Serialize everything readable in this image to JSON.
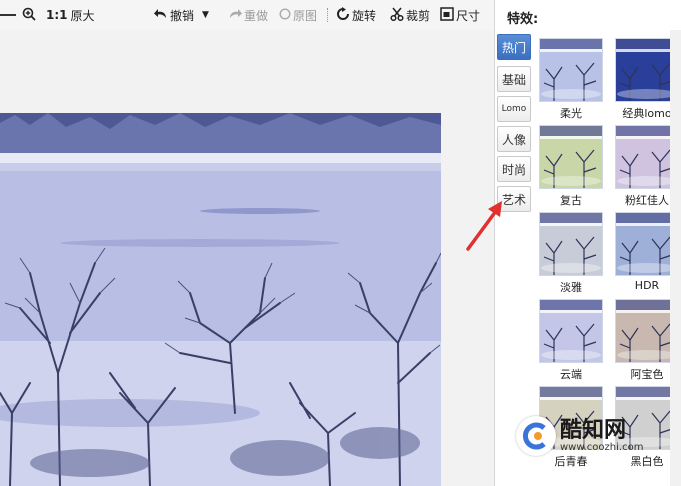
{
  "toolbar": {
    "zoom_fit_label": "1:1",
    "original_size_label": "原大",
    "undo_label": "撤销",
    "redo_label": "重做",
    "original_image_label": "原图",
    "rotate_label": "旋转",
    "crop_label": "裁剪",
    "size_label": "尺寸"
  },
  "panel": {
    "title": "特效:",
    "tabs": [
      {
        "label": "热门"
      },
      {
        "label": "基础"
      },
      {
        "label": "Lomo"
      },
      {
        "label": "人像"
      },
      {
        "label": "时尚"
      },
      {
        "label": "艺术"
      }
    ],
    "effects": [
      {
        "label": "柔光",
        "tint": "#b7c2e6"
      },
      {
        "label": "经典lomo",
        "tint": "#2a3f9a"
      },
      {
        "label": "复古",
        "tint": "#c9d6a8"
      },
      {
        "label": "粉红佳人",
        "tint": "#cfc3e0"
      },
      {
        "label": "淡雅",
        "tint": "#c8ccd8"
      },
      {
        "label": "HDR",
        "tint": "#9eb0d8"
      },
      {
        "label": "云端",
        "tint": "#c3c6e6"
      },
      {
        "label": "阿宝色",
        "tint": "#c8b8b0"
      },
      {
        "label": "后青春",
        "tint": "#d6d2c0"
      },
      {
        "label": "黑白色",
        "tint": "#d0d0d0"
      }
    ]
  },
  "watermark": {
    "name": "酷知网",
    "url": "www.coozhi.com"
  },
  "colors": {
    "active_tab": "#3a6fc0",
    "arrow": "#e03030"
  }
}
